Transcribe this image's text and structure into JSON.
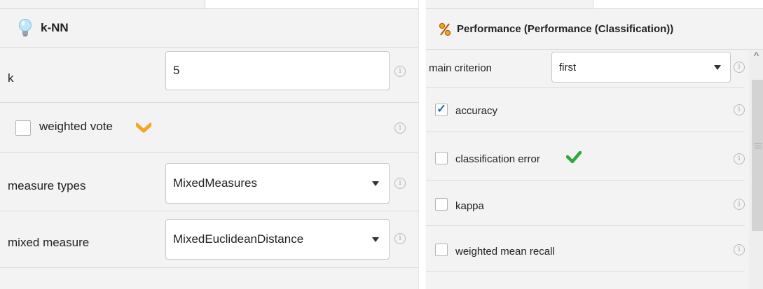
{
  "knn_panel": {
    "title": "k-NN",
    "icon": "lightbulb-icon",
    "params": {
      "k": {
        "label": "k",
        "value": "5"
      },
      "weighted_vote": {
        "label": "weighted vote",
        "checked": false
      },
      "measure_types": {
        "label": "measure types",
        "value": "MixedMeasures"
      },
      "mixed_measure": {
        "label": "mixed measure",
        "value": "MixedEuclideanDistance"
      }
    }
  },
  "performance_panel": {
    "title": "Performance (Performance (Classification))",
    "icon": "percent-icon",
    "params": {
      "main_criterion": {
        "label": "main criterion",
        "value": "first"
      },
      "accuracy": {
        "label": "accuracy",
        "checked": true
      },
      "classification_error": {
        "label": "classification error",
        "checked": false
      },
      "kappa": {
        "label": "kappa",
        "checked": false
      },
      "weighted_mean_recall": {
        "label": "weighted mean recall",
        "checked": false
      }
    }
  },
  "icons": {
    "info": "info-icon",
    "weighted_vote_marker": "chevron-down-icon",
    "classification_error_marker": "checkmark-icon"
  },
  "colors": {
    "panel_bg": "#f3f3f3",
    "weighted_vote_marker": "#f5a623",
    "classification_error_marker": "#2fa83f",
    "check": "#2a6fbf"
  }
}
